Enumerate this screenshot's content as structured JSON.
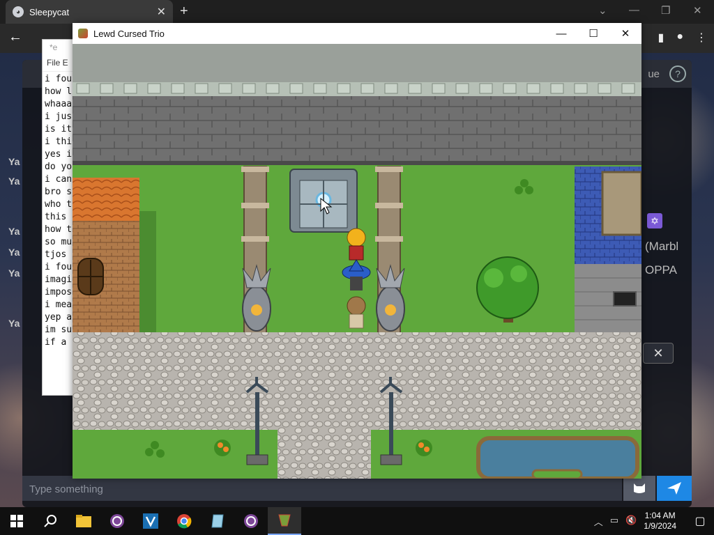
{
  "browser": {
    "tab_title": "Sleepycat",
    "close_glyph": "✕",
    "new_tab_glyph": "+"
  },
  "notepad": {
    "title_partial": "*e",
    "menu_partial": "File  E",
    "lines": [
      "i fou",
      "how l",
      "whaaa",
      "i jus",
      "is it",
      "i thi",
      "yes i",
      "do yo",
      "i can",
      "bro s",
      "who t",
      "this ",
      "how t",
      "so mu",
      "tjos ",
      "i fou",
      "imagi",
      "impos",
      "i mea",
      "yep a",
      "im su",
      "if a "
    ]
  },
  "chat": {
    "header_partial": "ue",
    "side_labels": [
      "Ya",
      "Ya",
      "Ya",
      "Ya",
      "Ya",
      "Ya"
    ],
    "right_line1": "(Marbl",
    "right_line2": "OPPA",
    "star_glyph": "✡",
    "input_placeholder": "Type something",
    "close_glyph": "✕",
    "send_glyph": "➤",
    "cat_glyph": "🐱"
  },
  "game": {
    "title": "Lewd Cursed Trio",
    "minimize_glyph": "—",
    "maximize_glyph": "☐",
    "close_glyph": "✕"
  },
  "taskbar": {
    "time": "1:04 AM",
    "date": "1/9/2024",
    "apps": [
      "windows-start",
      "search",
      "file-explorer",
      "tor-browser",
      "visual-studio-v",
      "chrome",
      "notepad",
      "tor-browser-2",
      "game"
    ]
  },
  "colors": {
    "accent": "#1e88e5",
    "grass": "#5fa83c",
    "wall": "#6e6e6e",
    "roof_orange": "#d9762f",
    "roof_blue": "#3d5bb5",
    "water": "#4a7f9e"
  }
}
